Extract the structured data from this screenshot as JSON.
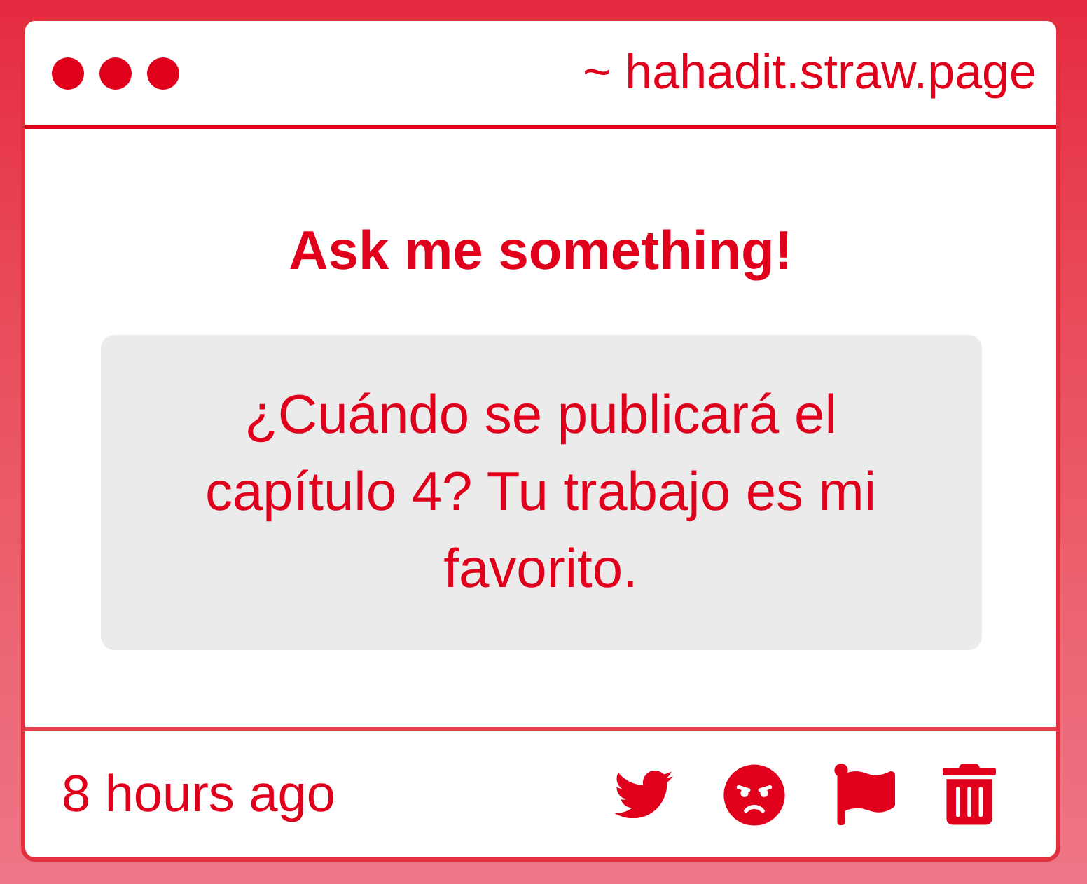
{
  "header": {
    "url": "~ hahadit.straw.page"
  },
  "prompt": {
    "title": "Ask me something!"
  },
  "question": {
    "text": "¿Cuándo se publicará el capítulo 4? Tu trabajo es mi favorito."
  },
  "footer": {
    "time": "8 hours ago"
  }
}
